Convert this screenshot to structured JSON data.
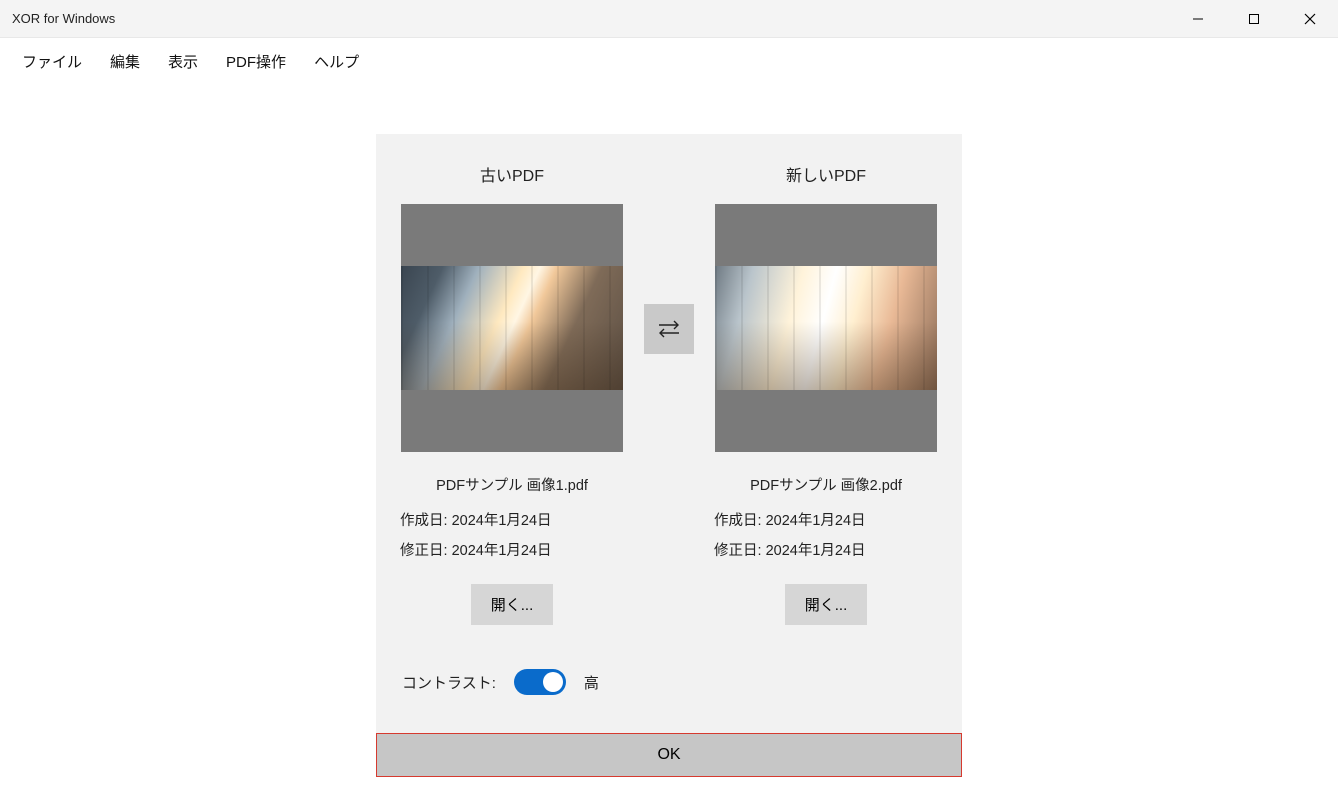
{
  "window": {
    "title": "XOR for Windows"
  },
  "menu": {
    "items": [
      "ファイル",
      "編集",
      "表示",
      "PDF操作",
      "ヘルプ"
    ]
  },
  "compare": {
    "left": {
      "title": "古いPDF",
      "filename": "PDFサンプル 画像1.pdf",
      "created_label": "作成日:",
      "created_value": "2024年1月24日",
      "modified_label": "修正日:",
      "modified_value": "2024年1月24日",
      "open_label": "開く..."
    },
    "right": {
      "title": "新しいPDF",
      "filename": "PDFサンプル 画像2.pdf",
      "created_label": "作成日:",
      "created_value": "2024年1月24日",
      "modified_label": "修正日:",
      "modified_value": "2024年1月24日",
      "open_label": "開く..."
    },
    "swap_icon": "swap"
  },
  "contrast": {
    "label": "コントラスト:",
    "value": "高",
    "state": "on"
  },
  "footer": {
    "ok_label": "OK"
  }
}
